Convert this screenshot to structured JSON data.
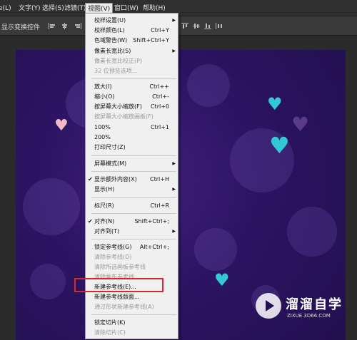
{
  "menubar": {
    "items": [
      {
        "label": "e(L)"
      },
      {
        "label": "文字(Y)"
      },
      {
        "label": "选择(S)"
      },
      {
        "label": "滤镜(T)"
      },
      {
        "label": "视图(V)"
      },
      {
        "label": "窗口(W)"
      },
      {
        "label": "帮助(H)"
      }
    ]
  },
  "options_bar": {
    "transform_controls_label": "显示变换控件"
  },
  "view_menu": {
    "items": [
      {
        "label": "校样设置(U)",
        "shortcut": "",
        "submenu": true,
        "checked": false,
        "disabled": false
      },
      {
        "label": "校样颜色(L)",
        "shortcut": "Ctrl+Y",
        "submenu": false,
        "checked": false,
        "disabled": false
      },
      {
        "label": "色域警告(W)",
        "shortcut": "Shift+Ctrl+Y",
        "submenu": false,
        "checked": false,
        "disabled": false
      },
      {
        "label": "像素长宽比(S)",
        "shortcut": "",
        "submenu": true,
        "checked": false,
        "disabled": false
      },
      {
        "label": "像素长宽比校正(P)",
        "shortcut": "",
        "submenu": false,
        "checked": false,
        "disabled": true
      },
      {
        "label": "32 位预览选项...",
        "shortcut": "",
        "submenu": false,
        "checked": false,
        "disabled": true
      },
      {
        "label": "放大(I)",
        "shortcut": "Ctrl++",
        "submenu": false,
        "checked": false,
        "disabled": false
      },
      {
        "label": "缩小(O)",
        "shortcut": "Ctrl+-",
        "submenu": false,
        "checked": false,
        "disabled": false
      },
      {
        "label": "按屏幕大小缩放(F)",
        "shortcut": "Ctrl+0",
        "submenu": false,
        "checked": false,
        "disabled": false
      },
      {
        "label": "按屏幕大小缩放画板(F)",
        "shortcut": "",
        "submenu": false,
        "checked": false,
        "disabled": true
      },
      {
        "label": "100%",
        "shortcut": "Ctrl+1",
        "submenu": false,
        "checked": false,
        "disabled": false
      },
      {
        "label": "200%",
        "shortcut": "",
        "submenu": false,
        "checked": false,
        "disabled": false
      },
      {
        "label": "打印尺寸(Z)",
        "shortcut": "",
        "submenu": false,
        "checked": false,
        "disabled": false
      },
      {
        "label": "屏幕模式(M)",
        "shortcut": "",
        "submenu": true,
        "checked": false,
        "disabled": false
      },
      {
        "label": "显示额外内容(X)",
        "shortcut": "Ctrl+H",
        "submenu": false,
        "checked": true,
        "disabled": false
      },
      {
        "label": "显示(H)",
        "shortcut": "",
        "submenu": true,
        "checked": false,
        "disabled": false
      },
      {
        "label": "标尺(R)",
        "shortcut": "Ctrl+R",
        "submenu": false,
        "checked": false,
        "disabled": false
      },
      {
        "label": "对齐(N)",
        "shortcut": "Shift+Ctrl+;",
        "submenu": false,
        "checked": true,
        "disabled": false
      },
      {
        "label": "对齐到(T)",
        "shortcut": "",
        "submenu": true,
        "checked": false,
        "disabled": false
      },
      {
        "label": "锁定参考线(G)",
        "shortcut": "Alt+Ctrl+;",
        "submenu": false,
        "checked": false,
        "disabled": false
      },
      {
        "label": "清除参考线(D)",
        "shortcut": "",
        "submenu": false,
        "checked": false,
        "disabled": true
      },
      {
        "label": "清除所选画板参考线",
        "shortcut": "",
        "submenu": false,
        "checked": false,
        "disabled": true
      },
      {
        "label": "清除画布参考线",
        "shortcut": "",
        "submenu": false,
        "checked": false,
        "disabled": true
      },
      {
        "label": "新建参考线(E)...",
        "shortcut": "",
        "submenu": false,
        "checked": false,
        "disabled": false
      },
      {
        "label": "新建参考线版面...",
        "shortcut": "",
        "submenu": false,
        "checked": false,
        "disabled": false
      },
      {
        "label": "通过形状新建参考线(A)",
        "shortcut": "",
        "submenu": false,
        "checked": false,
        "disabled": true
      },
      {
        "label": "锁定切片(K)",
        "shortcut": "",
        "submenu": false,
        "checked": false,
        "disabled": false
      },
      {
        "label": "清除切片(C)",
        "shortcut": "",
        "submenu": false,
        "checked": false,
        "disabled": true
      }
    ]
  },
  "watermark": {
    "title": "溜溜自学",
    "url": "ZIXUE.3D66.COM"
  },
  "colors": {
    "accent_heart_cyan": "#33c8d6",
    "accent_heart_pink": "#f2b8c6",
    "accent_heart_purple": "#5a3a8a",
    "highlight_red": "#d62a2a",
    "canvas_purple": "#2c1462"
  }
}
